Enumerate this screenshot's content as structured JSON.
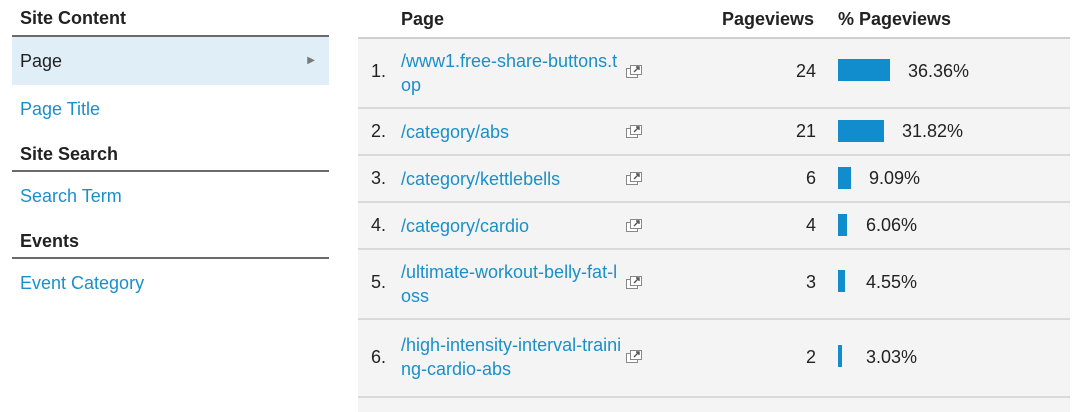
{
  "sidebar": {
    "site_content": {
      "title": "Site Content",
      "items": [
        {
          "label": "Page",
          "active": true
        },
        {
          "label": "Page Title",
          "active": false
        }
      ]
    },
    "site_search": {
      "title": "Site Search",
      "items": [
        {
          "label": "Search Term"
        }
      ]
    },
    "events": {
      "title": "Events",
      "items": [
        {
          "label": "Event Category"
        }
      ]
    }
  },
  "table": {
    "columns": {
      "page": "Page",
      "pageviews": "Pageviews",
      "pct": "% Pageviews"
    },
    "bar_color": "#118ccd",
    "rows": [
      {
        "index": "1.",
        "page": "/www1.free-share-buttons.top",
        "pageviews": "24",
        "pct": "36.36%",
        "share": 0.3636
      },
      {
        "index": "2.",
        "page": "/category/abs",
        "pageviews": "21",
        "pct": "31.82%",
        "share": 0.3182
      },
      {
        "index": "3.",
        "page": "/category/kettlebells",
        "pageviews": "6",
        "pct": "9.09%",
        "share": 0.0909
      },
      {
        "index": "4.",
        "page": "/category/cardio",
        "pageviews": "4",
        "pct": "6.06%",
        "share": 0.0606
      },
      {
        "index": "5.",
        "page": "/ultimate-workout-belly-fat-loss",
        "pageviews": "3",
        "pct": "4.55%",
        "share": 0.0455
      },
      {
        "index": "6.",
        "page": "/high-intensity-interval-training-cardio-abs",
        "pageviews": "2",
        "pct": "3.03%",
        "share": 0.0303
      }
    ]
  },
  "icons": {
    "external": "open-in-new-window-icon"
  }
}
